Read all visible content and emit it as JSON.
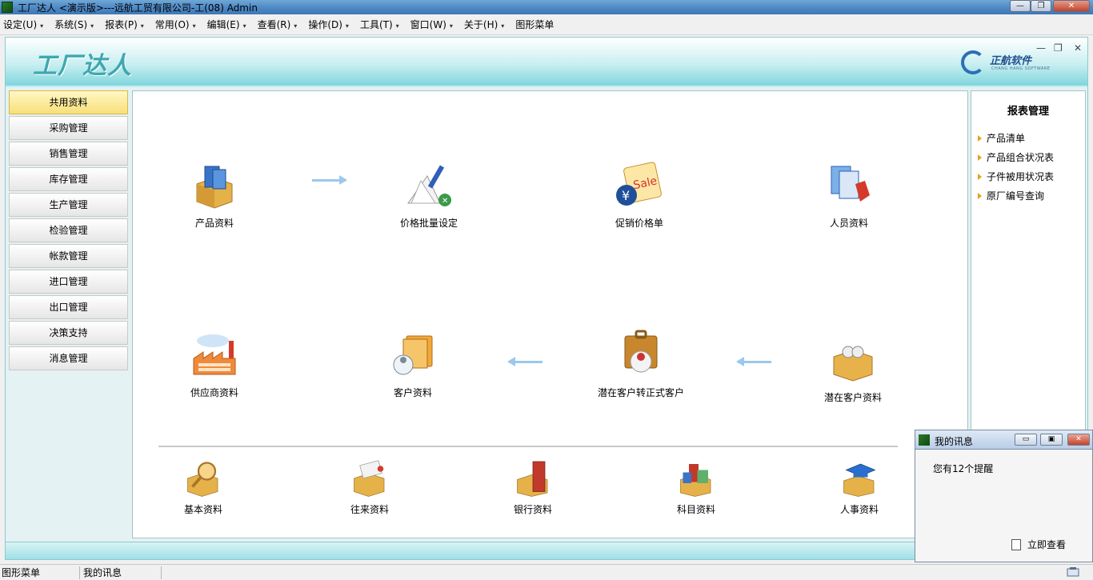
{
  "window": {
    "title": "工厂达人 <演示版>---远航工贸有限公司-工(08) Admin",
    "controls": {
      "minimize": "—",
      "maximize": "❐",
      "close": "✕"
    }
  },
  "menubar": [
    {
      "label": "设定(U)"
    },
    {
      "label": "系统(S)"
    },
    {
      "label": "报表(P)"
    },
    {
      "label": "常用(O)"
    },
    {
      "label": "编辑(E)"
    },
    {
      "label": "查看(R)"
    },
    {
      "label": "操作(D)"
    },
    {
      "label": "工具(T)"
    },
    {
      "label": "窗口(W)"
    },
    {
      "label": "关于(H)"
    },
    {
      "label": "图形菜单"
    }
  ],
  "banner": {
    "logo": "工厂达人",
    "brand_name": "正航软件",
    "brand_sub": "CHANG HANG SOFTWARE",
    "inner_controls": {
      "minimize": "—",
      "restore": "❐",
      "close": "✕"
    }
  },
  "sidebar": {
    "items": [
      {
        "label": "共用资料",
        "active": true
      },
      {
        "label": "采购管理"
      },
      {
        "label": "销售管理"
      },
      {
        "label": "库存管理"
      },
      {
        "label": "生产管理"
      },
      {
        "label": "检验管理"
      },
      {
        "label": "帐款管理"
      },
      {
        "label": "进口管理"
      },
      {
        "label": "出口管理"
      },
      {
        "label": "决策支持"
      },
      {
        "label": "消息管理"
      }
    ]
  },
  "main": {
    "row1": [
      {
        "label": "产品资料",
        "icon": "box-books-icon"
      },
      {
        "label": "价格批量设定",
        "icon": "price-batch-icon"
      },
      {
        "label": "促销价格单",
        "icon": "sale-tag-icon"
      },
      {
        "label": "人员资料",
        "icon": "personnel-icon"
      }
    ],
    "row2": [
      {
        "label": "供应商资料",
        "icon": "factory-icon"
      },
      {
        "label": "客户资料",
        "icon": "customer-folder-icon"
      },
      {
        "label": "潜在客户转正式客户",
        "icon": "convert-customer-icon"
      },
      {
        "label": "潜在客户资料",
        "icon": "prospect-box-icon"
      }
    ],
    "row3": [
      {
        "label": "基本资料",
        "icon": "magnifier-box-icon"
      },
      {
        "label": "往来资料",
        "icon": "mail-box-icon"
      },
      {
        "label": "银行资料",
        "icon": "bank-icon"
      },
      {
        "label": "科目资料",
        "icon": "account-books-icon"
      },
      {
        "label": "人事资料",
        "icon": "graduation-cap-icon"
      }
    ]
  },
  "right_panel": {
    "title": "报表管理",
    "items": [
      {
        "label": "产品清单"
      },
      {
        "label": "产品组合状况表"
      },
      {
        "label": "子件被用状况表"
      },
      {
        "label": "原厂编号查询"
      }
    ]
  },
  "notification": {
    "title": "我的讯息",
    "message": "您有12个提醒",
    "link": "立即查看"
  },
  "statusbar": {
    "cell1": "图形菜单",
    "cell2": "我的讯息"
  }
}
